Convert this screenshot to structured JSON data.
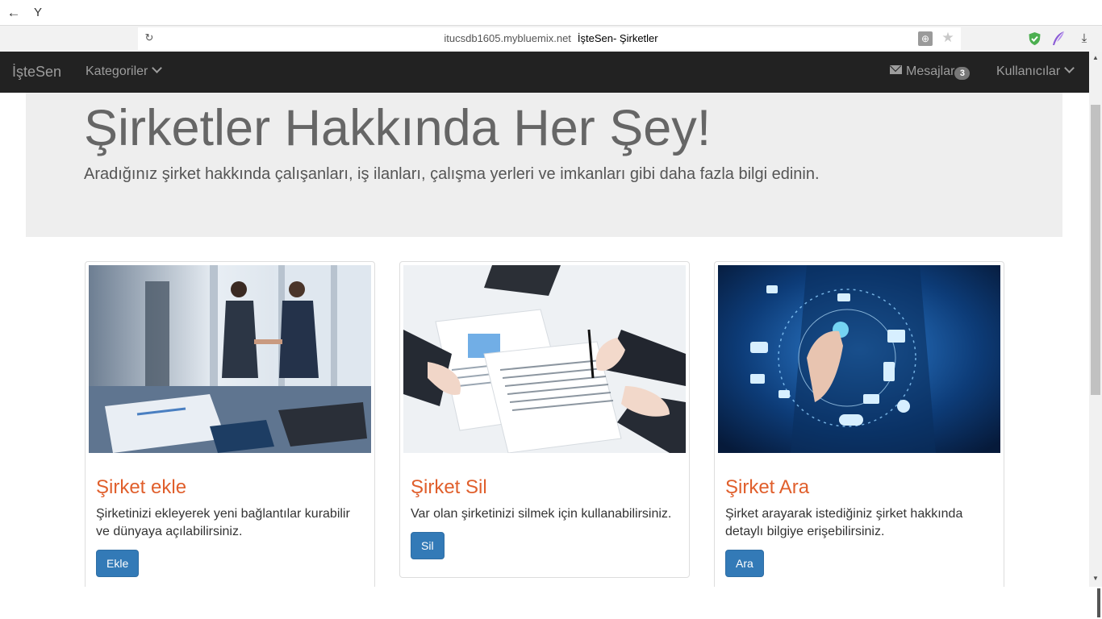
{
  "browser": {
    "domain": "itucsdb1605.mybluemix.net",
    "page_title": "İşteSen- Şirketler",
    "icons": [
      "back-arrow-icon",
      "yandex-logo-icon",
      "reload-icon",
      "globe-icon",
      "star-icon",
      "shield-icon",
      "feather-icon",
      "download-icon"
    ],
    "y_logo": "Y"
  },
  "navbar": {
    "brand": "İşteSen",
    "categories_label": "Kategoriler",
    "messages_label": "Mesajlar",
    "messages_count": "3",
    "users_label": "Kullanıcılar"
  },
  "jumbotron": {
    "title": "Şirketler Hakkında Her Şey!",
    "lead": "Aradığınız şirket hakkında çalışanları, iş ilanları, çalışma yerleri ve imkanları gibi daha fazla bilgi edinin."
  },
  "cards": [
    {
      "title": "Şirket ekle",
      "text": "Şirketinizi ekleyerek yeni bağlantılar kurabilir ve dünyaya açılabilirsiniz.",
      "button": "Ekle"
    },
    {
      "title": "Şirket Sil",
      "text": "Var olan şirketinizi silmek için kullanabilirsiniz.",
      "button": "Sil"
    },
    {
      "title": "Şirket Ara",
      "text": "Şirket arayarak istediğiniz şirket hakkında detaylı bilgiye erişebilirsiniz.",
      "button": "Ara"
    }
  ],
  "colors": {
    "navbar_bg": "#222222",
    "card_title": "#e05f2c",
    "button_primary": "#337ab7",
    "jumbotron_bg": "#eeeeee"
  }
}
